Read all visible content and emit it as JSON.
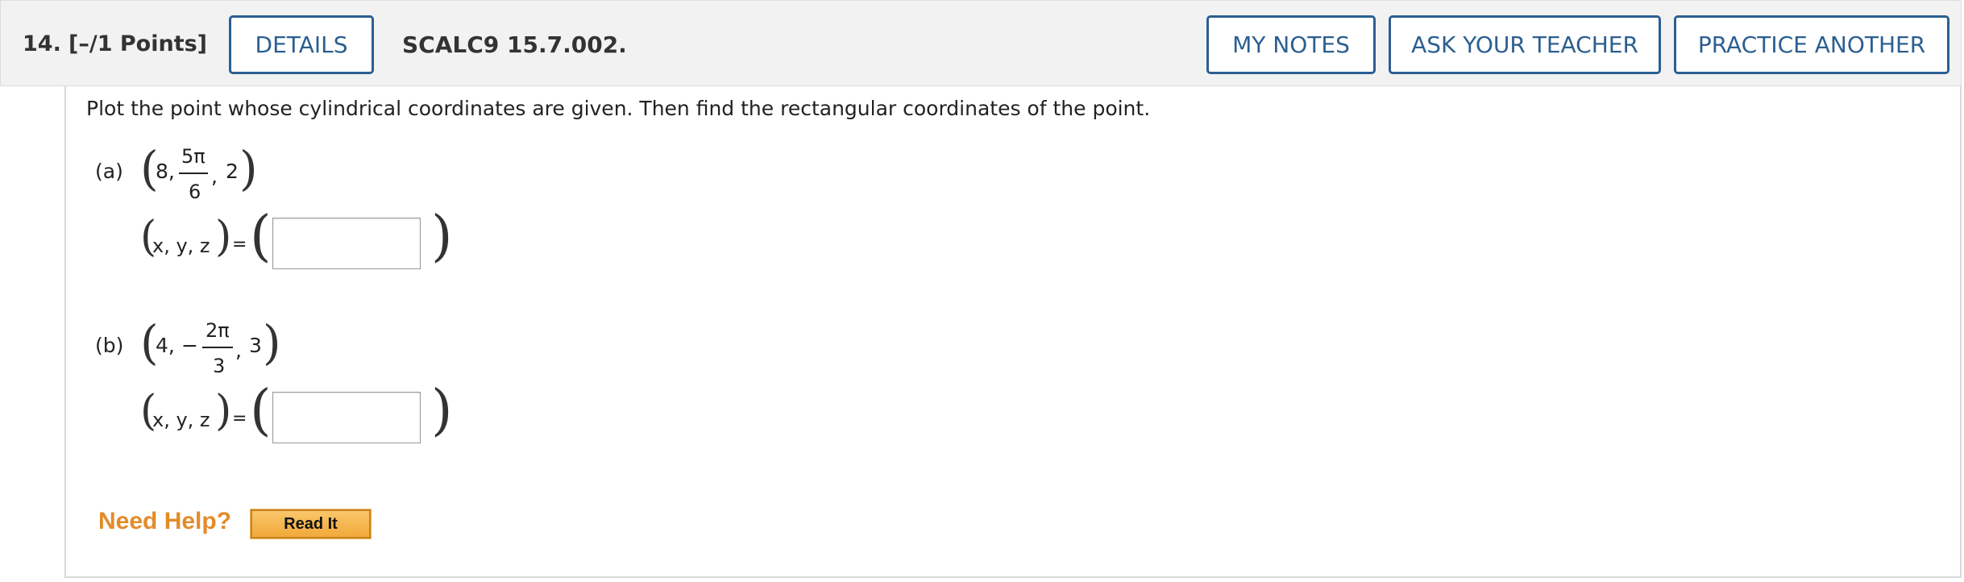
{
  "header": {
    "question_number": "14.",
    "points": "[–/1 Points]",
    "details_label": "DETAILS",
    "question_code": "SCALC9 15.7.002.",
    "my_notes_label": "MY NOTES",
    "ask_teacher_label": "ASK YOUR TEACHER",
    "practice_another_label": "PRACTICE ANOTHER"
  },
  "question": {
    "prompt": "Plot the point whose cylindrical coordinates are given. Then find the rectangular coordinates of the point.",
    "parts": [
      {
        "label": "(a)",
        "r": "8,",
        "sign": "",
        "theta_numerator": "5π",
        "theta_denominator": "6",
        "z": "2",
        "answer_lhs": "x, y, z",
        "equals": "=",
        "answer_value": ""
      },
      {
        "label": "(b)",
        "r": "4,",
        "sign": "−",
        "theta_numerator": "2π",
        "theta_denominator": "3",
        "z": "3",
        "answer_lhs": "x, y, z",
        "equals": "=",
        "answer_value": ""
      }
    ]
  },
  "help": {
    "need_help_label": "Need Help?",
    "read_it_label": "Read It"
  },
  "colors": {
    "button_border": "#2b5f91",
    "given_value_red": "#c0221f",
    "need_help_orange": "#e38b2b",
    "header_bg": "#f2f2f2"
  }
}
